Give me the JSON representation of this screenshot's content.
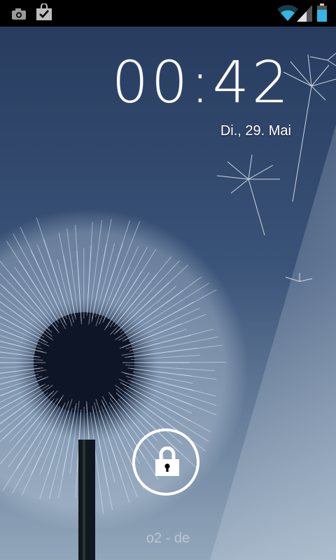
{
  "status_bar": {
    "left_icons": [
      "camera-icon",
      "shopping-bag-check-icon"
    ],
    "right_icons": [
      "wifi-icon",
      "signal-icon",
      "battery-icon"
    ],
    "colors": {
      "background": "#000000",
      "wifi": "#33b5e5",
      "battery": "#33b5e5"
    }
  },
  "lockscreen": {
    "time": "00:42",
    "date": "Di., 29. Mai",
    "carrier": "o2 - de",
    "unlock_icon": "padlock-icon"
  },
  "wallpaper": {
    "subject": "dandelion",
    "colors": {
      "sky_top": "#263a5c",
      "sky_bottom": "#8fa3b8"
    }
  }
}
